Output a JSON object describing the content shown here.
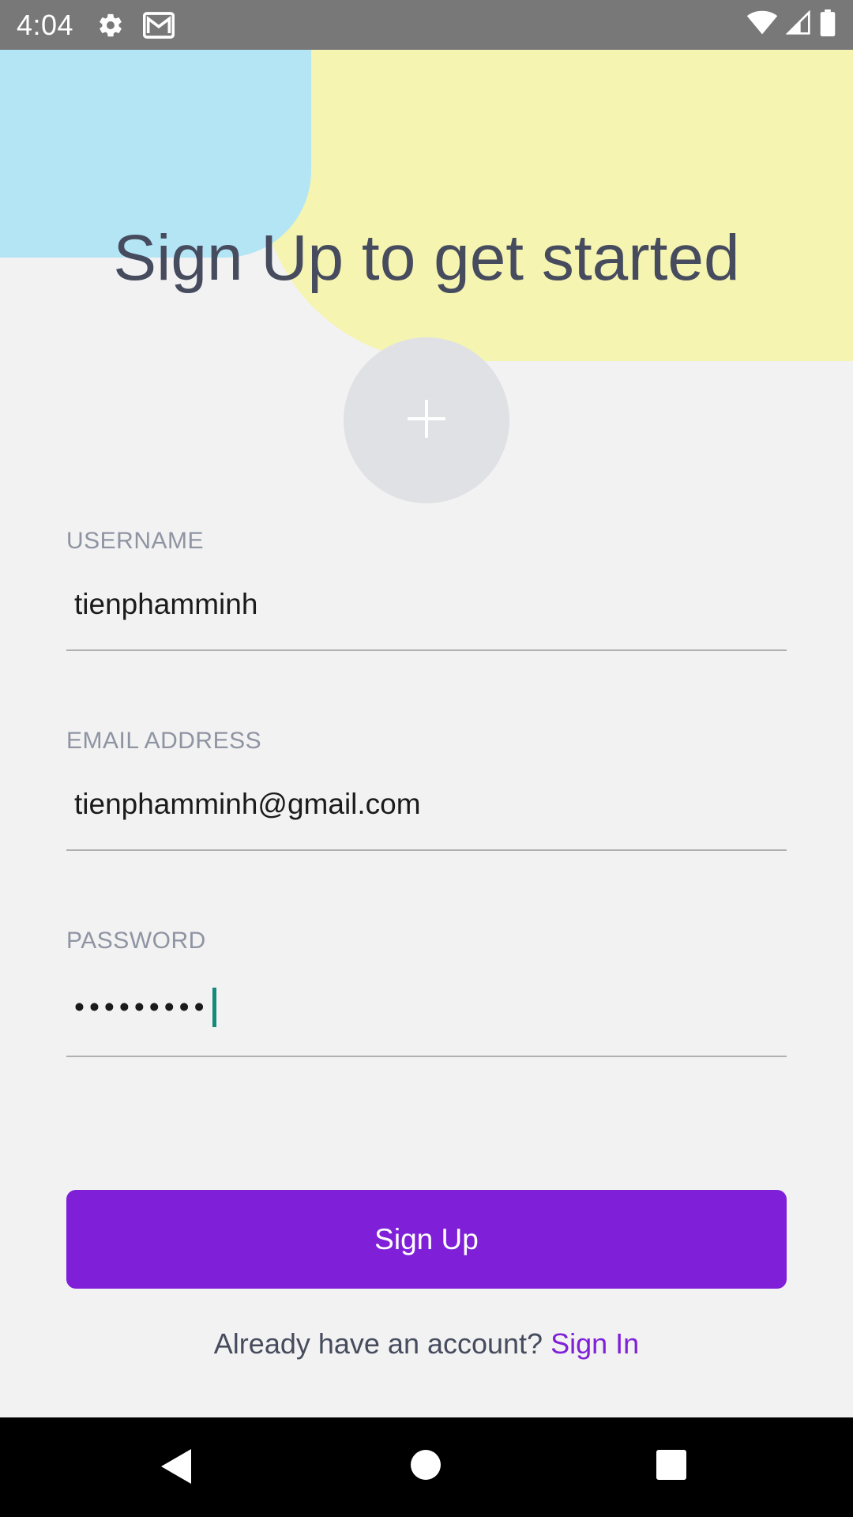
{
  "status_bar": {
    "time": "4:04",
    "icons": [
      "settings-icon",
      "gmail-icon",
      "wifi-icon",
      "signal-icon",
      "battery-icon"
    ]
  },
  "header": {
    "title": "Sign Up to get started"
  },
  "avatar": {
    "icon": "plus-icon"
  },
  "form": {
    "username": {
      "label": "USERNAME",
      "value": "tienphamminh"
    },
    "email": {
      "label": "EMAIL ADDRESS",
      "value": "tienphamminh@gmail.com"
    },
    "password": {
      "label": "PASSWORD",
      "value": "•••••••••"
    }
  },
  "actions": {
    "signup_label": "Sign Up",
    "signin_prompt": "Already have an account?",
    "signin_label": "Sign In"
  },
  "colors": {
    "accent": "#7f20d8",
    "blob_blue": "#b3e5f5",
    "blob_yellow": "#f5f4b1",
    "caret": "#138a7c"
  },
  "nav_bar": {
    "icons": [
      "back-icon",
      "home-icon",
      "recents-icon"
    ]
  }
}
